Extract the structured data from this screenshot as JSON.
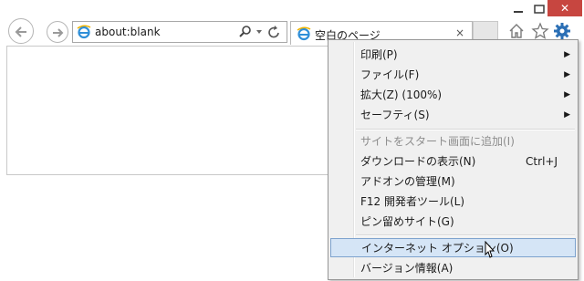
{
  "window": {
    "close_glyph": "✕"
  },
  "address_bar": {
    "url": "about:blank"
  },
  "tab": {
    "title": "空白のページ",
    "close_glyph": "×"
  },
  "menu": {
    "items": [
      {
        "label": "印刷(P)",
        "submenu": true
      },
      {
        "label": "ファイル(F)",
        "submenu": true
      },
      {
        "label": "拡大(Z) (100%)",
        "submenu": true
      },
      {
        "label": "セーフティ(S)",
        "submenu": true
      },
      {
        "label": "サイトをスタート画面に追加(I)",
        "disabled": true
      },
      {
        "label": "ダウンロードの表示(N)",
        "shortcut": "Ctrl+J"
      },
      {
        "label": "アドオンの管理(M)"
      },
      {
        "label": "F12 開発者ツール(L)"
      },
      {
        "label": "ピン留めサイト(G)"
      },
      {
        "label": "インターネット オプション(O)",
        "highlighted": true
      },
      {
        "label": "バージョン情報(A)"
      }
    ],
    "arrow_glyph": "▶"
  },
  "colors": {
    "close_button": "#c74640",
    "gear": "#2b6fb5",
    "highlight": "#d5e5f6"
  }
}
